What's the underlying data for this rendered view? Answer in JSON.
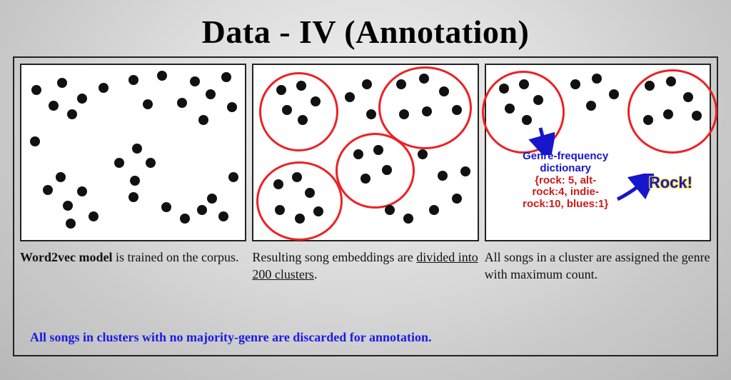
{
  "slide": {
    "title": "Data - IV (Annotation)",
    "footnote": "All songs in clusters with no majority-genre are discarded for annotation.",
    "panels": [
      {
        "caption_bold": "Word2vec model",
        "caption_rest": " is trained on the corpus."
      },
      {
        "caption_pre": "Resulting song embeddings are ",
        "caption_underline": "divided into 200 clusters",
        "caption_post": "."
      },
      {
        "caption": "All songs in a cluster are assigned the genre with maximum count."
      }
    ],
    "annotation": {
      "dict_title": "Genre-frequency dictionary",
      "dict_body": "{rock: 5, alt-rock:4, indie-rock:10, blues:1}",
      "result": "Rock!"
    }
  }
}
